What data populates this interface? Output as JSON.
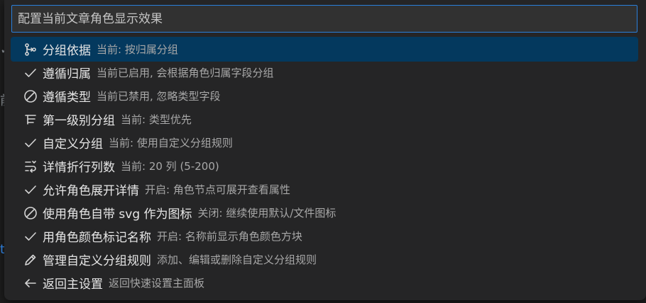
{
  "search": {
    "placeholder": "配置当前文章角色显示效果"
  },
  "background": {
    "glyph_1": "✓",
    "glyph_2": "前",
    "glyph_3": "t"
  },
  "items": [
    {
      "icon": "group-by-icon",
      "label": "分组依据",
      "description": "当前: 按归属分组",
      "selected": true
    },
    {
      "icon": "check-icon",
      "label": "遵循归属",
      "description": "当前已启用, 会根据角色归属字段分组",
      "selected": false
    },
    {
      "icon": "disabled-icon",
      "label": "遵循类型",
      "description": "当前已禁用, 忽略类型字段",
      "selected": false
    },
    {
      "icon": "list-tree-icon",
      "label": "第一级别分组",
      "description": "当前: 类型优先",
      "selected": false
    },
    {
      "icon": "check-icon",
      "label": "自定义分组",
      "description": "当前: 使用自定义分组规则",
      "selected": false
    },
    {
      "icon": "word-wrap-icon",
      "label": "详情折行列数",
      "description": "当前: 20 列 (5-200)",
      "selected": false
    },
    {
      "icon": "check-icon",
      "label": "允许角色展开详情",
      "description": "开启: 角色节点可展开查看属性",
      "selected": false
    },
    {
      "icon": "disabled-icon",
      "label": "使用角色自带 svg 作为图标",
      "description": "关闭: 继续使用默认/文件图标",
      "selected": false
    },
    {
      "icon": "check-icon",
      "label": "用角色颜色标记名称",
      "description": "开启: 名称前显示角色颜色方块",
      "selected": false
    },
    {
      "icon": "edit-icon",
      "label": "管理自定义分组规则",
      "description": "添加、编辑或删除自定义分组规则",
      "selected": false
    },
    {
      "icon": "arrow-left-icon",
      "label": "返回主设置",
      "description": "返回快速设置主面板",
      "selected": false
    }
  ],
  "colors": {
    "accent": "#2a7fdb",
    "selected_bg": "#04395e"
  }
}
